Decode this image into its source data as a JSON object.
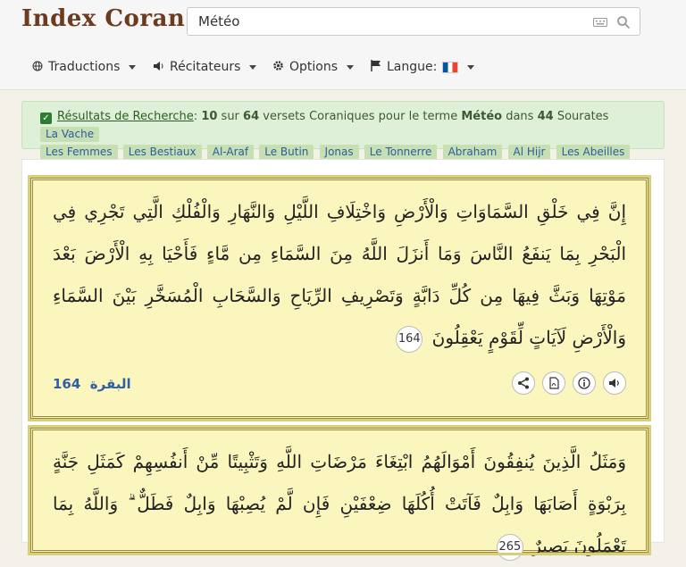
{
  "header": {
    "logo": "Index Coran",
    "search": {
      "value": "Météo"
    }
  },
  "nav": [
    {
      "label": "Traductions",
      "icon": "globe-icon"
    },
    {
      "label": "Récitateurs",
      "icon": "speaker-icon"
    },
    {
      "label": "Options",
      "icon": "gear-icon"
    },
    {
      "label": "Langue:",
      "icon": "flag-icon",
      "flag": "fr"
    }
  ],
  "results": {
    "title": "Résultats de Recherche",
    "count": "10",
    "word_sur": "sur",
    "total": "64",
    "text_mid": "versets Coraniques pour le terme",
    "term": "Météo",
    "word_dans": "dans",
    "sourates_count": "44",
    "word_sourates": "Sourates",
    "tags": [
      "La Vache",
      "Les Femmes",
      "Les Bestiaux",
      "Al-Araf",
      "Le Butin",
      "Jonas",
      "Le Tonnerre",
      "Abraham",
      "Al Hijr",
      "Les Abeilles",
      "..."
    ]
  },
  "verses": [
    {
      "text": "إِنَّ فِي خَلْقِ السَّمَاوَاتِ وَالْأَرْضِ وَاخْتِلَافِ اللَّيْلِ وَالنَّهَارِ وَالْفُلْكِ الَّتِي تَجْرِي فِي الْبَحْرِ بِمَا يَنفَعُ النَّاسَ وَمَا أَنزَلَ اللَّهُ مِنَ السَّمَاءِ مِن مَّاءٍ فَأَحْيَا بِهِ الْأَرْضَ بَعْدَ مَوْتِهَا وَبَثَّ فِيهَا مِن كُلِّ دَابَّةٍ وَتَصْرِيفِ الرِّيَاحِ وَالسَّحَابِ الْمُسَخَّرِ بَيْنَ السَّمَاءِ وَالْأَرْضِ لَآيَاتٍ لِّقَوْمٍ يَعْقِلُونَ",
      "number": "164",
      "surah": "البقرة",
      "ref_number": "164"
    },
    {
      "text": "وَمَثَلُ الَّذِينَ يُنفِقُونَ أَمْوَالَهُمُ ابْتِغَاءَ مَرْضَاتِ اللَّهِ وَتَثْبِيتًا مِّنْ أَنفُسِهِمْ كَمَثَلِ جَنَّةٍ بِرَبْوَةٍ أَصَابَهَا وَابِلٌ فَآتَتْ أُكُلَهَا ضِعْفَيْنِ فَإِن لَّمْ يُصِبْهَا وَابِلٌ فَطَلٌّ ۗ وَاللَّهُ بِمَا تَعْمَلُونَ بَصِيرٌ",
      "number": "265"
    }
  ],
  "actions": [
    "share-icon",
    "pdf-icon",
    "info-icon",
    "audio-icon"
  ]
}
